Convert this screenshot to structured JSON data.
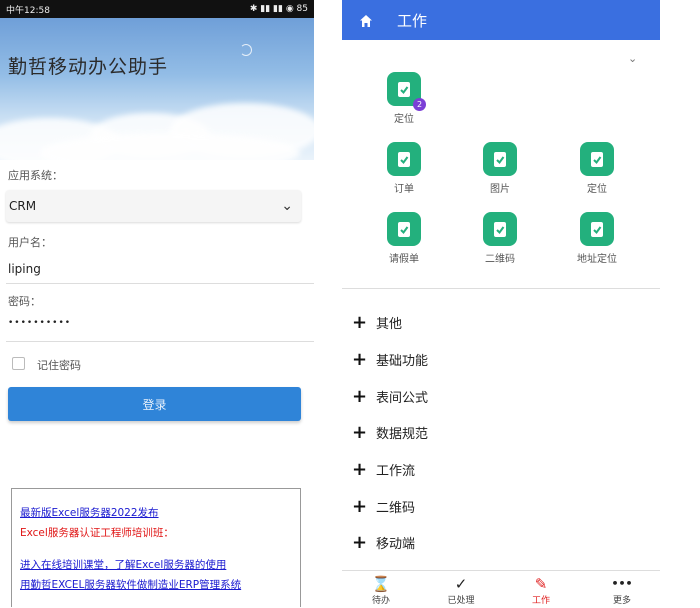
{
  "left": {
    "status": {
      "time": "中午12:58",
      "right": "✱ ▮▮ ▮▮ ◉ 85"
    },
    "app_title": "勤哲移动办公助手",
    "app_system_label": "应用系统：",
    "app_system_value": "CRM",
    "username_label": "用户名：",
    "username_value": "liping",
    "password_label": "密码：",
    "password_value": "••••••••••",
    "remember_label": "记住密码",
    "login_label": "登录",
    "notice": {
      "line1": "最新版Excel服务器2022发布",
      "line2": "Excel服务器认证工程师培训班：",
      "line3": "进入在线培训课堂，了解Excel服务器的使用",
      "line4": "用勤哲EXCEL服务器软件做制造业ERP管理系统"
    }
  },
  "right": {
    "header_title": "工作",
    "collapse_icon": "chevron-down-icon",
    "tiles": [
      {
        "label": "定位",
        "badge": "2"
      },
      {
        "label": "订单"
      },
      {
        "label": "图片"
      },
      {
        "label": "定位"
      },
      {
        "label": "请假单"
      },
      {
        "label": "二维码"
      },
      {
        "label": "地址定位"
      }
    ],
    "categories": [
      "其他",
      "基础功能",
      "表间公式",
      "数据规范",
      "工作流",
      "二维码",
      "移动端"
    ],
    "tabs": [
      {
        "label": "待办",
        "icon": "⌛"
      },
      {
        "label": "已处理",
        "icon": "✓"
      },
      {
        "label": "工作",
        "icon": "✎",
        "active": true
      },
      {
        "label": "更多",
        "icon": "•••"
      }
    ],
    "active_color": "#e02020",
    "accent": "#3a6fe0",
    "tile_color": "#23b07d"
  }
}
